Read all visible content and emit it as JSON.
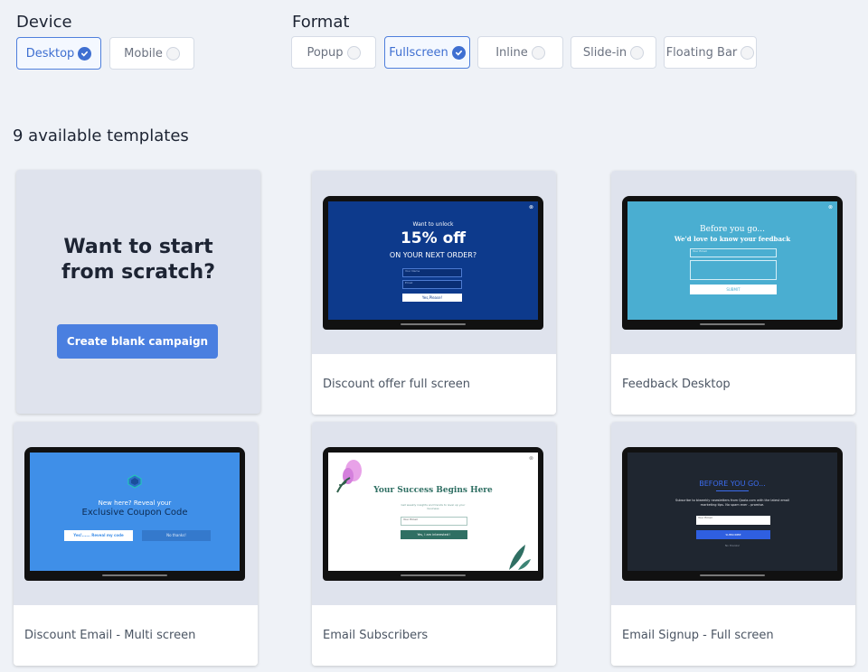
{
  "device": {
    "label": "Device",
    "options": [
      "Desktop",
      "Mobile"
    ],
    "selected": "Desktop"
  },
  "format": {
    "label": "Format",
    "options": [
      "Popup",
      "Fullscreen",
      "Inline",
      "Slide-in",
      "Floating Bar"
    ],
    "selected": "Fullscreen"
  },
  "templates_count": "9 available templates",
  "blank": {
    "title_line1": "Want to start",
    "title_line2": "from scratch?",
    "button": "Create blank campaign"
  },
  "templates": [
    {
      "name": "Discount offer full screen",
      "preview": {
        "line1": "Want to unlock",
        "line2": "15% off",
        "line3": "ON YOUR NEXT ORDER?",
        "field1": "Your Name",
        "field2": "Email",
        "button": "Yes,Please!"
      }
    },
    {
      "name": "Feedback Desktop",
      "preview": {
        "line1": "Before you go...",
        "line2": "We'd love to know your feedback",
        "field": "Your Email",
        "button": "SUBMIT"
      }
    },
    {
      "name": "Discount Email - Multi screen",
      "preview": {
        "line1": "New here? Reveal your",
        "line2": "Exclusive Coupon Code",
        "button1": "Yes!...... Reveal my code",
        "button2": "No thanks!"
      }
    },
    {
      "name": "Email Subscribers",
      "preview": {
        "line1": "Your Success Begins Here",
        "line2": "Get weekly insights and trends to level up your business",
        "field": "Your Email",
        "button": "Yes, I am interested !"
      }
    },
    {
      "name": "Email Signup - Full screen",
      "preview": {
        "line1": "BEFORE YOU GO...",
        "line2": "Subscribe to biweekly newsletters from Qoala.com with the latest email marketing tips. No spam ever - promise.",
        "field": "Your Email",
        "button": "SUBSCRIBE",
        "footer": "No thanks!"
      }
    }
  ],
  "colors": {
    "accent": "#4a7fe0",
    "card_bg": "#dfe3ed",
    "page_bg": "#eff2f7"
  }
}
